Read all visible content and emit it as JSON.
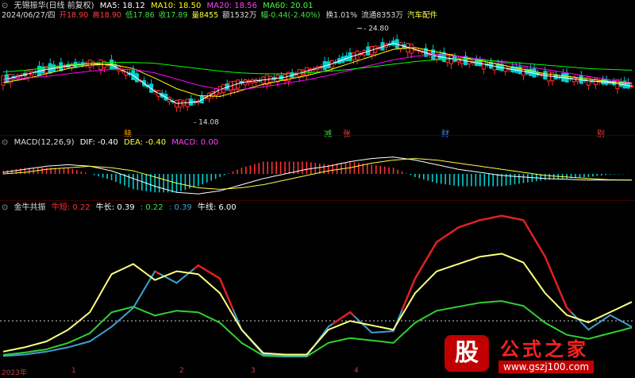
{
  "header": {
    "icon": "expand-icon",
    "stock": "无锡振华(日线 前复权)",
    "ma5": "MA5: 18.12",
    "ma10": "MA10: 18.50",
    "ma20": "MA20: 18.56",
    "ma60": "MA60: 20.01"
  },
  "quote": {
    "date": "2024/06/27/四",
    "open": "开18.90",
    "high": "高18.90",
    "low": "低17.86",
    "close": "收17.89",
    "volume": "量8455",
    "amount": "额1532万",
    "change": "幅-0.44(-2.40%)",
    "turnover": "换1.01%",
    "float": "流通8353万",
    "sector": "汽车配件"
  },
  "price_annotations": {
    "high_label": "24.80",
    "low_label": "14.08"
  },
  "event_markers": [
    "赎",
    "减",
    "张",
    "财",
    "别"
  ],
  "macd_header": {
    "title": "MACD(12,26,9)",
    "dif": "DIF: -0.40",
    "dea": "DEA: -0.40",
    "macd": "MACD: 0.00"
  },
  "indicator_header": {
    "title": "金牛共振",
    "nd": "牛短",
    "nd_val": ": 0.22",
    "nc": "牛长",
    "nc_val": ": 0.39",
    "v3": ": 0.22",
    "v4": ": 0.39",
    "nx": "牛线",
    "nx_val": ": 6.00"
  },
  "x_axis": [
    "2023年",
    "1",
    "2",
    "3",
    "4"
  ],
  "watermark": {
    "char": "股",
    "title": "公式之家",
    "url": "www.gszj100.com"
  },
  "colors": {
    "up": "#ff3030",
    "down": "#00d0d0",
    "ma5": "#ffffff",
    "ma10": "#ffff00",
    "ma20": "#ff00ff",
    "ma60": "#00ff00",
    "bull_short": "#ffff80",
    "bull_long": "#40a0d0",
    "green_line": "#30d030",
    "red_line": "#e02020",
    "ref_line": "#d0d0d0"
  },
  "chart_data": [
    {
      "type": "candlestick",
      "title": "无锡振华(日线 前复权)",
      "series": [
        {
          "name": "MA5",
          "values": [
            18.9,
            19.5,
            20.1,
            20.5,
            20.8,
            20.6,
            19.4,
            17.6,
            16.2,
            16.4,
            17.8,
            18.6,
            18.9,
            19.2,
            19.9,
            20.6,
            21.5,
            22.3,
            23.1,
            22.4,
            21.6,
            21.2,
            20.8,
            20.3,
            19.9,
            19.4,
            19.1,
            18.8,
            18.6,
            18.2
          ]
        },
        {
          "name": "MA10",
          "values": [
            18.6,
            19.0,
            19.6,
            20.2,
            20.6,
            20.7,
            20.2,
            19.1,
            17.9,
            17.1,
            17.0,
            17.7,
            18.4,
            18.9,
            19.4,
            20.0,
            20.8,
            21.6,
            22.4,
            22.6,
            22.1,
            21.6,
            21.1,
            20.6,
            20.1,
            19.6,
            19.3,
            19.0,
            18.7,
            18.5
          ]
        },
        {
          "name": "MA20",
          "values": [
            18.9,
            19.1,
            19.3,
            19.6,
            19.9,
            20.1,
            20.1,
            19.7,
            19.0,
            18.3,
            17.8,
            17.8,
            18.1,
            18.5,
            18.9,
            19.4,
            20.0,
            20.6,
            21.2,
            21.6,
            21.8,
            21.6,
            21.3,
            20.9,
            20.5,
            20.1,
            19.7,
            19.3,
            18.9,
            18.56
          ]
        },
        {
          "name": "MA60",
          "values": [
            19.8,
            20.0,
            20.3,
            20.6,
            20.8,
            20.9,
            20.9,
            20.8,
            20.5,
            20.2,
            19.9,
            19.7,
            19.6,
            19.6,
            19.7,
            19.9,
            20.1,
            20.4,
            20.7,
            21.0,
            21.2,
            21.3,
            21.2,
            21.0,
            20.8,
            20.6,
            20.4,
            20.2,
            20.1,
            20.01
          ]
        }
      ],
      "annotations": {
        "high": 24.8,
        "low": 14.08
      }
    },
    {
      "type": "bar",
      "title": "MACD(12,26,9)",
      "series": [
        {
          "name": "DIF",
          "values": [
            0.1,
            0.3,
            0.5,
            0.6,
            0.5,
            0.2,
            -0.3,
            -0.8,
            -1.2,
            -1.3,
            -1.1,
            -0.7,
            -0.3,
            0.0,
            0.3,
            0.5,
            0.8,
            1.0,
            1.1,
            0.9,
            0.6,
            0.3,
            0.1,
            -0.1,
            -0.2,
            -0.3,
            -0.35,
            -0.4,
            -0.4,
            -0.4
          ]
        },
        {
          "name": "DEA",
          "values": [
            0.0,
            0.1,
            0.3,
            0.4,
            0.5,
            0.4,
            0.2,
            -0.2,
            -0.6,
            -0.9,
            -1.0,
            -0.9,
            -0.7,
            -0.4,
            -0.1,
            0.2,
            0.4,
            0.7,
            0.9,
            1.0,
            0.9,
            0.7,
            0.5,
            0.3,
            0.1,
            -0.1,
            -0.2,
            -0.3,
            -0.38,
            -0.4
          ]
        },
        {
          "name": "MACD",
          "values": [
            0.2,
            0.4,
            0.4,
            0.4,
            0.0,
            -0.4,
            -1.0,
            -1.2,
            -1.2,
            -0.8,
            -0.2,
            0.4,
            0.8,
            0.8,
            0.8,
            0.6,
            0.8,
            0.6,
            0.4,
            -0.2,
            -0.6,
            -0.8,
            -0.8,
            -0.8,
            -0.6,
            -0.4,
            -0.3,
            -0.2,
            -0.04,
            0.0
          ]
        }
      ]
    },
    {
      "type": "line",
      "title": "金牛共振",
      "series": [
        {
          "name": "牛短",
          "values": [
            0.02,
            0.03,
            0.05,
            0.08,
            0.12,
            0.22,
            0.35,
            0.6,
            0.52,
            0.64,
            0.55,
            0.2,
            0.03,
            0.02,
            0.02,
            0.22,
            0.32,
            0.18,
            0.19,
            0.55,
            0.8,
            0.9,
            0.95,
            0.98,
            0.95,
            0.7,
            0.35,
            0.2,
            0.3,
            0.22
          ]
        },
        {
          "name": "牛长",
          "values": [
            0.05,
            0.08,
            0.12,
            0.2,
            0.32,
            0.58,
            0.65,
            0.54,
            0.6,
            0.58,
            0.45,
            0.2,
            0.04,
            0.03,
            0.03,
            0.2,
            0.26,
            0.23,
            0.2,
            0.45,
            0.6,
            0.65,
            0.7,
            0.72,
            0.66,
            0.45,
            0.3,
            0.25,
            0.32,
            0.39
          ]
        },
        {
          "name": "牛线",
          "values": [
            6,
            6,
            6,
            6,
            6,
            6,
            6,
            6,
            6,
            6,
            6,
            6,
            6,
            6,
            6,
            6,
            6,
            6,
            6,
            6,
            6,
            6,
            6,
            6,
            6,
            6,
            6,
            6,
            6,
            6
          ]
        }
      ]
    }
  ]
}
